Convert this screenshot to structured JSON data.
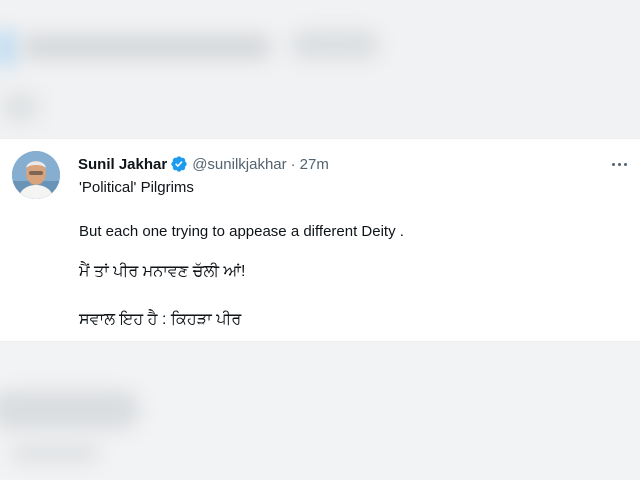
{
  "tweet": {
    "author_name": "Sunil Jakhar",
    "handle": "@sunilkjakhar",
    "separator": "·",
    "time": "27m",
    "lines": [
      "'Political' Pilgrims",
      "But each one trying to appease a different Deity .",
      "ਮੈਂ ਤਾਂ ਪੀਰ ਮਨਾਵਣ ਚੱਲੀ ਆਂ!",
      "ਸਵਾਲ ਇਹ ਹੈ : ਕਿਹੜਾ ਪੀਰ"
    ],
    "verified_color": "#1d9bf0",
    "more_icon": "more-horizontal-icon"
  }
}
